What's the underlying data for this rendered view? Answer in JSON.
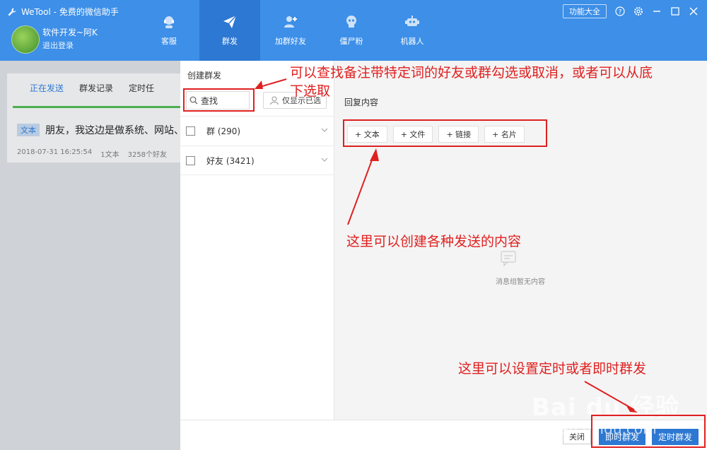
{
  "app": {
    "title": "WeTool - 免费的微信助手",
    "username": "软件开发~阿K",
    "logout": "退出登录",
    "func_button": "功能大全",
    "icons": [
      "help-icon",
      "settings-icon",
      "minimize-icon",
      "maximize-icon",
      "close-icon"
    ]
  },
  "nav": [
    {
      "label": "客服",
      "icon": "headset-icon",
      "active": false
    },
    {
      "label": "群发",
      "icon": "send-icon",
      "active": true
    },
    {
      "label": "加群好友",
      "icon": "add-friend-icon",
      "active": false
    },
    {
      "label": "僵尸粉",
      "icon": "skull-icon",
      "active": false
    },
    {
      "label": "机器人",
      "icon": "robot-icon",
      "active": false
    }
  ],
  "left": {
    "tabs": [
      "正在发送",
      "群发记录",
      "定时任"
    ],
    "message_tag": "文本",
    "message_text": "朋友，我这边是做系统、网站、",
    "meta_time": "2018-07-31 16:25:54",
    "meta_count": "1文本",
    "meta_friends": "3258个好友"
  },
  "modal": {
    "title": "创建群发",
    "search_text": "查找",
    "show_selected": "仅显示已选",
    "groups": [
      {
        "label": "群 (290)"
      },
      {
        "label": "好友 (3421)"
      }
    ],
    "reply_label": "回复内容",
    "add_buttons": [
      "+ 文本",
      "+ 文件",
      "+ 链接",
      "+ 名片"
    ],
    "empty_text": "消息组暂无内容",
    "close": "关闭",
    "send_now": "即时群发",
    "send_scheduled": "定时群发"
  },
  "annotations": {
    "top_line1": "可以查找备注带特定词的好友或群勾选或取消，或者可以从底",
    "top_line2": "下选取",
    "middle": "这里可以创建各种发送的内容",
    "bottom": "这里可以设置定时或者即时群发",
    "color": "#e02020"
  },
  "watermark": {
    "brand": "Bai du 经验",
    "sub": "jingyan.baidu.com"
  },
  "colors": {
    "header": "#3d8fe8",
    "active_nav": "#2d78d2",
    "accent": "#2d78d2"
  }
}
